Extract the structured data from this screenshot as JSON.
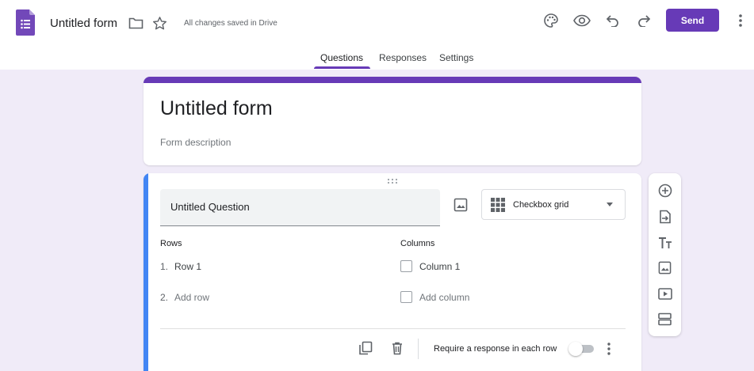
{
  "header": {
    "title": "Untitled form",
    "save_status": "All changes saved in Drive",
    "send_label": "Send",
    "icons": [
      "forms-logo-icon",
      "folder-icon",
      "star-icon",
      "palette-icon",
      "preview-eye-icon",
      "undo-icon",
      "redo-icon",
      "more-vert-icon"
    ]
  },
  "tabs": [
    {
      "label": "Questions",
      "active": true
    },
    {
      "label": "Responses",
      "active": false
    },
    {
      "label": "Settings",
      "active": false
    }
  ],
  "form": {
    "title": "Untitled form",
    "description_placeholder": "Form description"
  },
  "question": {
    "title": "Untitled Question",
    "type": "Checkbox grid",
    "rows_heading": "Rows",
    "columns_heading": "Columns",
    "rows": [
      {
        "num": "1.",
        "label": "Row 1"
      },
      {
        "num": "2.",
        "label": "Add row"
      }
    ],
    "columns": [
      "Column 1",
      "Add column"
    ],
    "required_label": "Require a response in each row",
    "required": false
  },
  "side_toolbar": {
    "icons": [
      "add-question-icon",
      "import-questions-icon",
      "add-title-icon",
      "add-image-icon",
      "add-video-icon",
      "add-section-icon"
    ]
  },
  "colors": {
    "accent": "#673ab7",
    "background": "#f0ebf8",
    "active_question_bar": "#4285f4"
  }
}
